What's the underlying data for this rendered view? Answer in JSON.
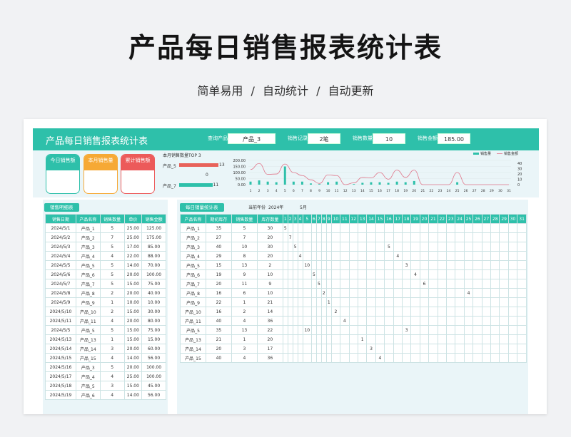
{
  "header": {
    "title": "产品每日销售报表统计表",
    "subtitle": "简单易用   /   自动统计   /   自动更新"
  },
  "banner": {
    "title": "产品每日销售报表统计表",
    "fields": [
      {
        "label": "查询产品",
        "value": "产品_3"
      },
      {
        "label": "销售记录",
        "value": "2笔"
      },
      {
        "label": "销售数量",
        "value": "10"
      },
      {
        "label": "销售金额",
        "value": "185.00"
      }
    ]
  },
  "cards": [
    {
      "label": "今日销售额",
      "color": "#2ec0aa"
    },
    {
      "label": "本月销售量",
      "color": "#f6a935"
    },
    {
      "label": "累计销售额",
      "color": "#ec5a5a"
    }
  ],
  "top3": {
    "title": "本月销售数量TOP 3",
    "items": [
      {
        "label": "产品_5",
        "value": 13,
        "color": "#e8625a"
      },
      {
        "label": "",
        "value": 0,
        "color": "#e8625a"
      },
      {
        "label": "产品_7",
        "value": 11,
        "color": "#2ec0aa"
      }
    ]
  },
  "chart_data": {
    "type": "bar",
    "legend": [
      "销售量",
      "销售金额"
    ],
    "categories": [
      "1",
      "2",
      "3",
      "4",
      "5",
      "6",
      "7",
      "8",
      "9",
      "10",
      "11",
      "12",
      "13",
      "14",
      "15",
      "16",
      "17",
      "18",
      "19",
      "20",
      "21",
      "22",
      "23",
      "24",
      "25",
      "26",
      "27",
      "28",
      "29",
      "30",
      "31"
    ],
    "series": [
      {
        "name": "销售量",
        "values": [
          5,
          7,
          5,
          4,
          30,
          5,
          5,
          2,
          1,
          4,
          5,
          0,
          1,
          3,
          4,
          4,
          3,
          5,
          4,
          6,
          0,
          0,
          0,
          0,
          4,
          0,
          0,
          0,
          0,
          0,
          0
        ]
      },
      {
        "name": "销售金额",
        "values": [
          125,
          175,
          85,
          88,
          170,
          100,
          75,
          40,
          10,
          80,
          75,
          0,
          15,
          60,
          56,
          100,
          45,
          120,
          60,
          120,
          0,
          0,
          0,
          0,
          100,
          0,
          0,
          0,
          0,
          0,
          0
        ]
      }
    ],
    "y_left": [
      "200.00",
      "150.00",
      "100.00",
      "50.00",
      "0.00"
    ],
    "y_right": [
      "40",
      "30",
      "20",
      "10",
      "0"
    ]
  },
  "detail": {
    "tag": "销售明细表",
    "headers": [
      "销售日期",
      "产品名称",
      "销售数量",
      "单价",
      "销售金额"
    ],
    "rows": [
      [
        "2024/5/1",
        "产品_1",
        "5",
        "25.00",
        "125.00"
      ],
      [
        "2024/5/2",
        "产品_2",
        "7",
        "25.00",
        "175.00"
      ],
      [
        "2024/5/3",
        "产品_3",
        "5",
        "17.00",
        "85.00"
      ],
      [
        "2024/5/4",
        "产品_4",
        "4",
        "22.00",
        "88.00"
      ],
      [
        "2024/5/5",
        "产品_5",
        "5",
        "14.00",
        "70.00"
      ],
      [
        "2024/5/6",
        "产品_6",
        "5",
        "20.00",
        "100.00"
      ],
      [
        "2024/5/7",
        "产品_7",
        "5",
        "15.00",
        "75.00"
      ],
      [
        "2024/5/8",
        "产品_8",
        "2",
        "20.00",
        "40.00"
      ],
      [
        "2024/5/9",
        "产品_9",
        "1",
        "10.00",
        "10.00"
      ],
      [
        "2024/5/10",
        "产品_10",
        "2",
        "15.00",
        "30.00"
      ],
      [
        "2024/5/11",
        "产品_11",
        "4",
        "20.00",
        "80.00"
      ],
      [
        "2024/5/5",
        "产品_5",
        "5",
        "15.00",
        "75.00"
      ],
      [
        "2024/5/13",
        "产品_13",
        "1",
        "15.00",
        "15.00"
      ],
      [
        "2024/5/14",
        "产品_14",
        "3",
        "20.00",
        "60.00"
      ],
      [
        "2024/5/15",
        "产品_15",
        "4",
        "14.00",
        "56.00"
      ],
      [
        "2024/5/16",
        "产品_3",
        "5",
        "20.00",
        "100.00"
      ],
      [
        "2024/5/17",
        "产品_4",
        "4",
        "25.00",
        "100.00"
      ],
      [
        "2024/5/18",
        "产品_5",
        "3",
        "15.00",
        "45.00"
      ],
      [
        "2024/5/19",
        "产品_6",
        "4",
        "14.00",
        "56.00"
      ]
    ]
  },
  "daily": {
    "tag": "每日销量统计表",
    "year_label": "当前年份",
    "year": "2024年",
    "month": "5月",
    "headers": [
      "产品名称",
      "期初库存",
      "销售数量",
      "库存数量"
    ],
    "days": [
      "1",
      "2",
      "3",
      "4",
      "5",
      "6",
      "7",
      "8",
      "9",
      "10",
      "11",
      "12",
      "13",
      "14",
      "15",
      "16",
      "17",
      "18",
      "19",
      "20",
      "21",
      "22",
      "23",
      "24",
      "25",
      "26",
      "27",
      "28",
      "29",
      "30",
      "31"
    ],
    "rows": [
      [
        "产品_1",
        "35",
        "5",
        "30"
      ],
      [
        "产品_2",
        "27",
        "7",
        "20"
      ],
      [
        "产品_3",
        "40",
        "10",
        "30"
      ],
      [
        "产品_4",
        "29",
        "8",
        "20"
      ],
      [
        "产品_5",
        "15",
        "13",
        "2"
      ],
      [
        "产品_6",
        "19",
        "9",
        "10"
      ],
      [
        "产品_7",
        "20",
        "11",
        "9"
      ],
      [
        "产品_8",
        "16",
        "6",
        "10"
      ],
      [
        "产品_9",
        "22",
        "1",
        "21"
      ],
      [
        "产品_10",
        "16",
        "2",
        "14"
      ],
      [
        "产品_11",
        "40",
        "4",
        "36"
      ],
      [
        "产品_5",
        "35",
        "13",
        "22"
      ],
      [
        "产品_13",
        "21",
        "1",
        "20"
      ],
      [
        "产品_14",
        "20",
        "3",
        "17"
      ],
      [
        "产品_15",
        "40",
        "4",
        "36"
      ]
    ],
    "marks": [
      [
        0,
        0,
        "5"
      ],
      [
        1,
        1,
        "7"
      ],
      [
        2,
        2,
        "5"
      ],
      [
        3,
        3,
        "4"
      ],
      [
        4,
        4,
        "10"
      ],
      [
        5,
        5,
        "5"
      ],
      [
        6,
        6,
        "5"
      ],
      [
        7,
        7,
        "2"
      ],
      [
        8,
        8,
        "1"
      ],
      [
        9,
        9,
        "2"
      ],
      [
        10,
        10,
        "4"
      ],
      [
        11,
        4,
        "10"
      ],
      [
        12,
        12,
        "1"
      ],
      [
        13,
        13,
        "3"
      ],
      [
        14,
        14,
        "4"
      ],
      [
        2,
        15,
        "5"
      ],
      [
        3,
        16,
        "4"
      ],
      [
        4,
        17,
        "3"
      ],
      [
        5,
        18,
        "4"
      ],
      [
        6,
        19,
        "6"
      ],
      [
        7,
        24,
        "4"
      ],
      [
        11,
        17,
        "3"
      ]
    ]
  }
}
